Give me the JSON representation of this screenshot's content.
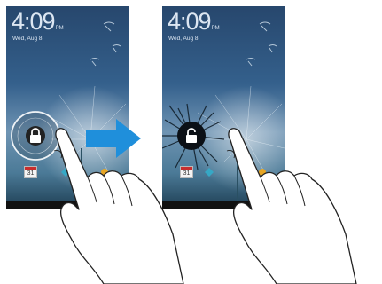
{
  "screens": [
    {
      "id": "left",
      "time": "4:09",
      "ampm": "PM",
      "date": "Wed, Aug 8",
      "lock_state": "locked",
      "calendar_day": "31"
    },
    {
      "id": "right",
      "time": "4:09",
      "ampm": "PM",
      "date": "Wed, Aug 8",
      "lock_state": "unlocked",
      "calendar_day": "31"
    }
  ],
  "icons": {
    "lock": "lock-icon",
    "unlock": "unlock-icon",
    "arrow": "arrow-right-icon",
    "hand": "pointing-hand-icon"
  },
  "colors": {
    "arrow": "#1f8fdb",
    "wallpaper_top": "#27476d",
    "wallpaper_mid": "#6f94b3",
    "text": "#dce6f2"
  }
}
